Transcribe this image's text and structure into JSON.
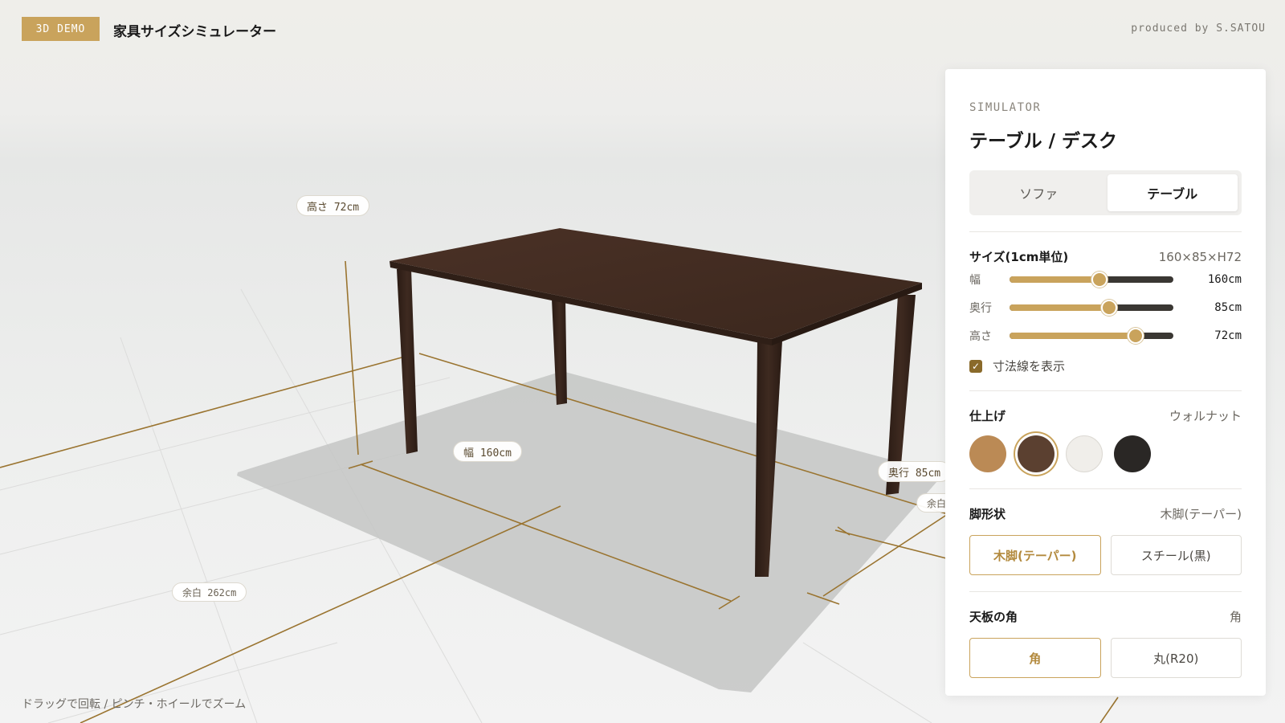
{
  "header": {
    "badge": "3D DEMO",
    "title": "家具サイズシミュレーター",
    "credit": "produced by S.SATOU"
  },
  "scene": {
    "hint": "ドラッグで回転 / ピンチ・ホイールでズーム",
    "dimension_labels": {
      "height": "高さ 72cm",
      "width": "幅 160cm",
      "depth": "奥行 85cm",
      "margin_left": "余白 262cm",
      "margin_right": "余白"
    },
    "colors": {
      "wood": "#3f2a20",
      "dimension_line": "#9a7430",
      "shadow": "#c9c9c8"
    }
  },
  "panel": {
    "eyebrow": "SIMULATOR",
    "title": "テーブル / デスク",
    "tabs": [
      {
        "label": "ソファ",
        "active": false
      },
      {
        "label": "テーブル",
        "active": true
      }
    ],
    "size": {
      "title": "サイズ(1cm単位)",
      "summary": "160×85×H72",
      "sliders": [
        {
          "label": "幅",
          "value": "160cm",
          "fraction": 0.55
        },
        {
          "label": "奥行",
          "value": "85cm",
          "fraction": 0.61
        },
        {
          "label": "高さ",
          "value": "72cm",
          "fraction": 0.77
        }
      ],
      "show_dimensions_label": "寸法線を表示",
      "show_dimensions_checked": true
    },
    "finish": {
      "title": "仕上げ",
      "selected": "ウォルナット",
      "swatches": [
        {
          "name": "oak-swatch",
          "color": "#bb8a55",
          "selected": false
        },
        {
          "name": "walnut-swatch",
          "color": "#5b4030",
          "selected": true
        },
        {
          "name": "white-swatch",
          "color": "#f0eeea",
          "selected": false
        },
        {
          "name": "black-swatch",
          "color": "#2a2725",
          "selected": false
        }
      ]
    },
    "legs": {
      "title": "脚形状",
      "selected": "木脚(テーパー)",
      "options": [
        {
          "label": "木脚(テーパー)",
          "active": true
        },
        {
          "label": "スチール(黒)",
          "active": false
        }
      ]
    },
    "corner": {
      "title": "天板の角",
      "selected": "角",
      "options": [
        {
          "label": "角",
          "active": true
        },
        {
          "label": "丸(R20)",
          "active": false
        }
      ]
    },
    "colors": {
      "accent": "#c9a35c"
    }
  }
}
